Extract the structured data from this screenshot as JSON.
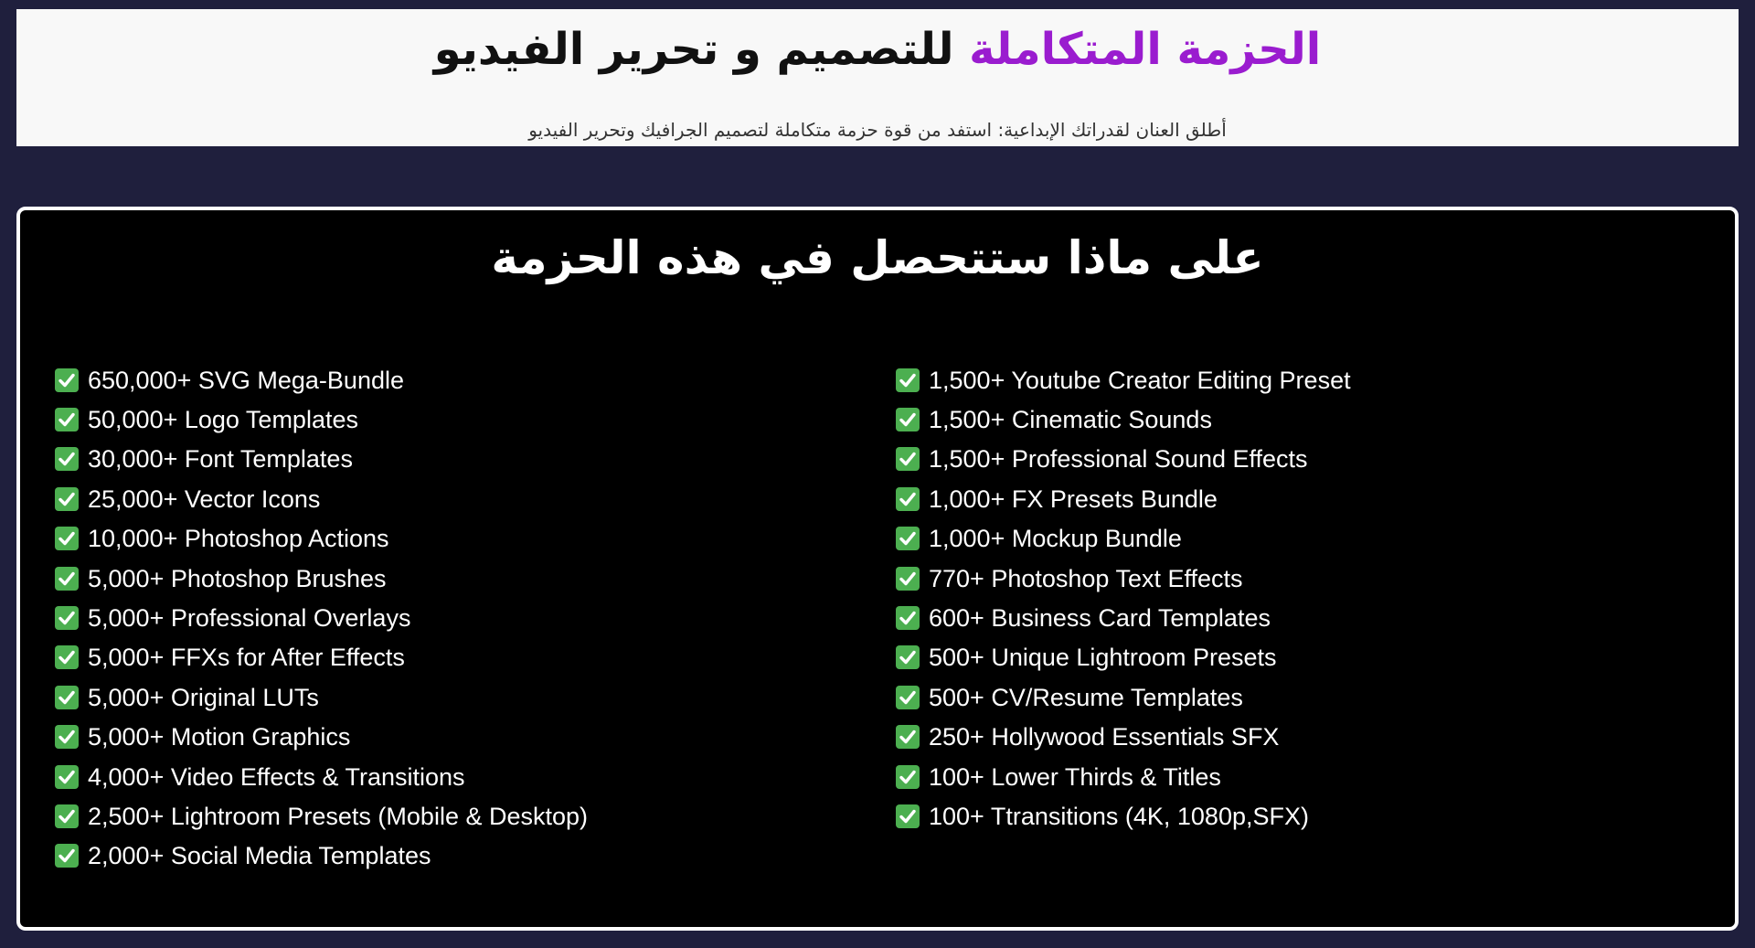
{
  "hero": {
    "title_accent": "الحزمة المتكاملة",
    "title_rest": " للتصميم و تحرير الفيديو",
    "subtitle": "أطلق العنان لقدراتك الإبداعية: استفد من قوة حزمة متكاملة لتصميم الجرافيك وتحرير الفيديو"
  },
  "panel": {
    "title": "على ماذا ستتحصل في هذه الحزمة",
    "check_icon": "check-mark-icon",
    "check_color": "#4caf50",
    "left_items": [
      "650,000+ SVG Mega-Bundle",
      "50,000+ Logo Templates",
      "30,000+ Font Templates",
      "25,000+ Vector Icons",
      "10,000+ Photoshop Actions",
      "5,000+ Photoshop Brushes",
      "5,000+ Professional Overlays",
      "5,000+ FFXs for After Effects",
      "5,000+ Original LUTs",
      "5,000+ Motion Graphics",
      "4,000+ Video Effects & Transitions",
      "2,500+ Lightroom Presets (Mobile & Desktop)",
      "2,000+ Social Media Templates"
    ],
    "right_items": [
      "1,500+ Youtube Creator Editing Preset",
      "1,500+ Cinematic Sounds",
      "1,500+ Professional Sound Effects",
      "1,000+ FX Presets Bundle",
      "1,000+ Mockup Bundle",
      "770+ Photoshop Text Effects",
      "600+ Business Card Templates",
      "500+ Unique Lightroom Presets",
      "500+ CV/Resume Templates",
      "250+ Hollywood Essentials SFX",
      "100+ Lower Thirds & Titles",
      "100+ Ttransitions (4K, 1080p,SFX)"
    ]
  },
  "colors": {
    "page_background": "#1f1f3d",
    "hero_background": "#f8f8f8",
    "accent": "#9a1ccf",
    "panel_background": "#000000"
  }
}
